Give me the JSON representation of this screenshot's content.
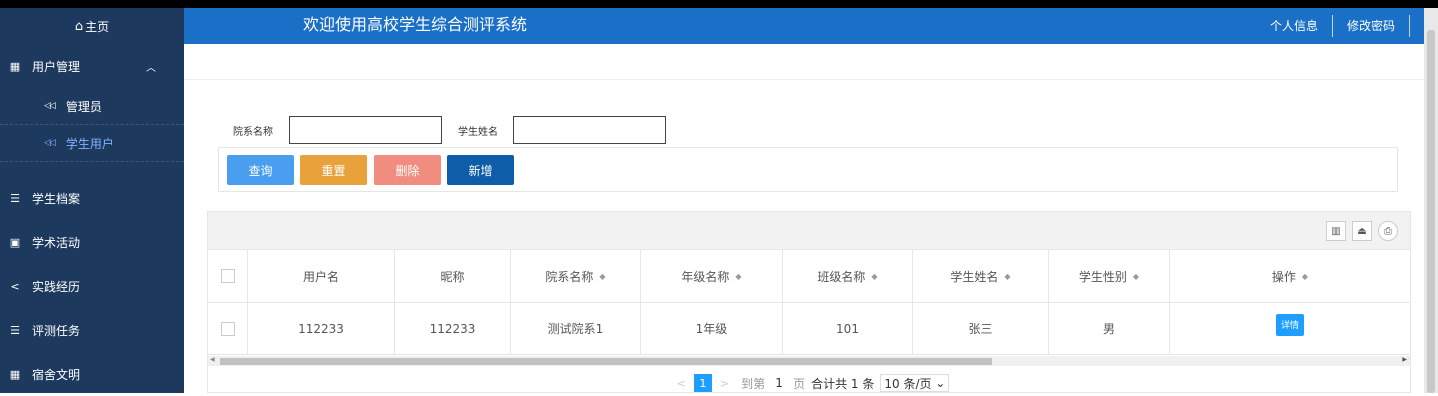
{
  "sidebar": {
    "home": "主页",
    "user_mgmt": "用户管理",
    "sub_items": [
      "管理员",
      "学生用户"
    ],
    "items": [
      "学生档案",
      "学术活动",
      "实践经历",
      "评测任务",
      "宿舍文明"
    ]
  },
  "header": {
    "title": "欢迎使用高校学生综合测评系统",
    "profile": "个人信息",
    "change_password": "修改密码"
  },
  "filter": {
    "dept_label": "院系名称",
    "name_label": "学生姓名",
    "dept_value": "",
    "name_value": ""
  },
  "buttons": {
    "query": "查询",
    "reset": "重置",
    "delete": "删除",
    "add": "新增"
  },
  "table": {
    "columns": [
      "用户名",
      "昵称",
      "院系名称",
      "年级名称",
      "班级名称",
      "学生姓名",
      "学生性别",
      "操作"
    ],
    "rows": [
      [
        "112233",
        "112233",
        "测试院系1",
        "1年级",
        "101",
        "张三",
        "男",
        "详情"
      ]
    ]
  },
  "pager": {
    "current": "1",
    "goto": "到第",
    "page_value": "1",
    "page_unit": "页",
    "total": "合计共 1 条",
    "page_size": "10 条/页"
  }
}
